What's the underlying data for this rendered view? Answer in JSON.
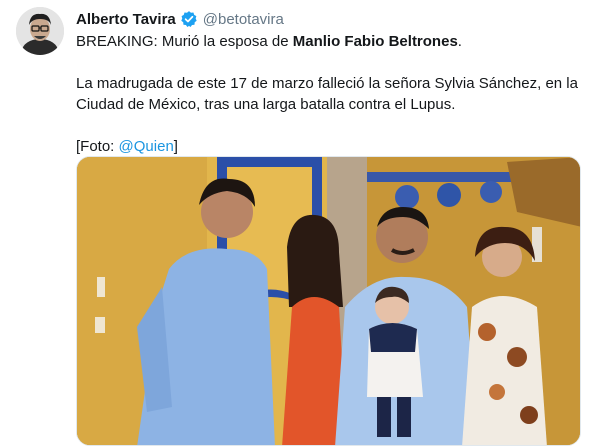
{
  "tweet": {
    "author_name": "Alberto Tavira",
    "handle": "@betotavira",
    "line1_prefix": "BREAKING: Murió la esposa de ",
    "line1_bold": "Manlio Fabio Beltrones",
    "line1_suffix": ".",
    "paragraph2": "La madrugada de este 17 de marzo falleció la señora Sylvia Sánchez, en la Ciudad de México, tras una larga batalla contra el Lupus.",
    "photo_credit_prefix": "[Foto: ",
    "photo_credit_link": "@Quien",
    "photo_credit_suffix": "]"
  },
  "colors": {
    "link": "#1b95e0",
    "verified_badge": "#1da1f2",
    "handle_gray": "#657786"
  },
  "icons": {
    "verified": "verified-badge-icon"
  }
}
